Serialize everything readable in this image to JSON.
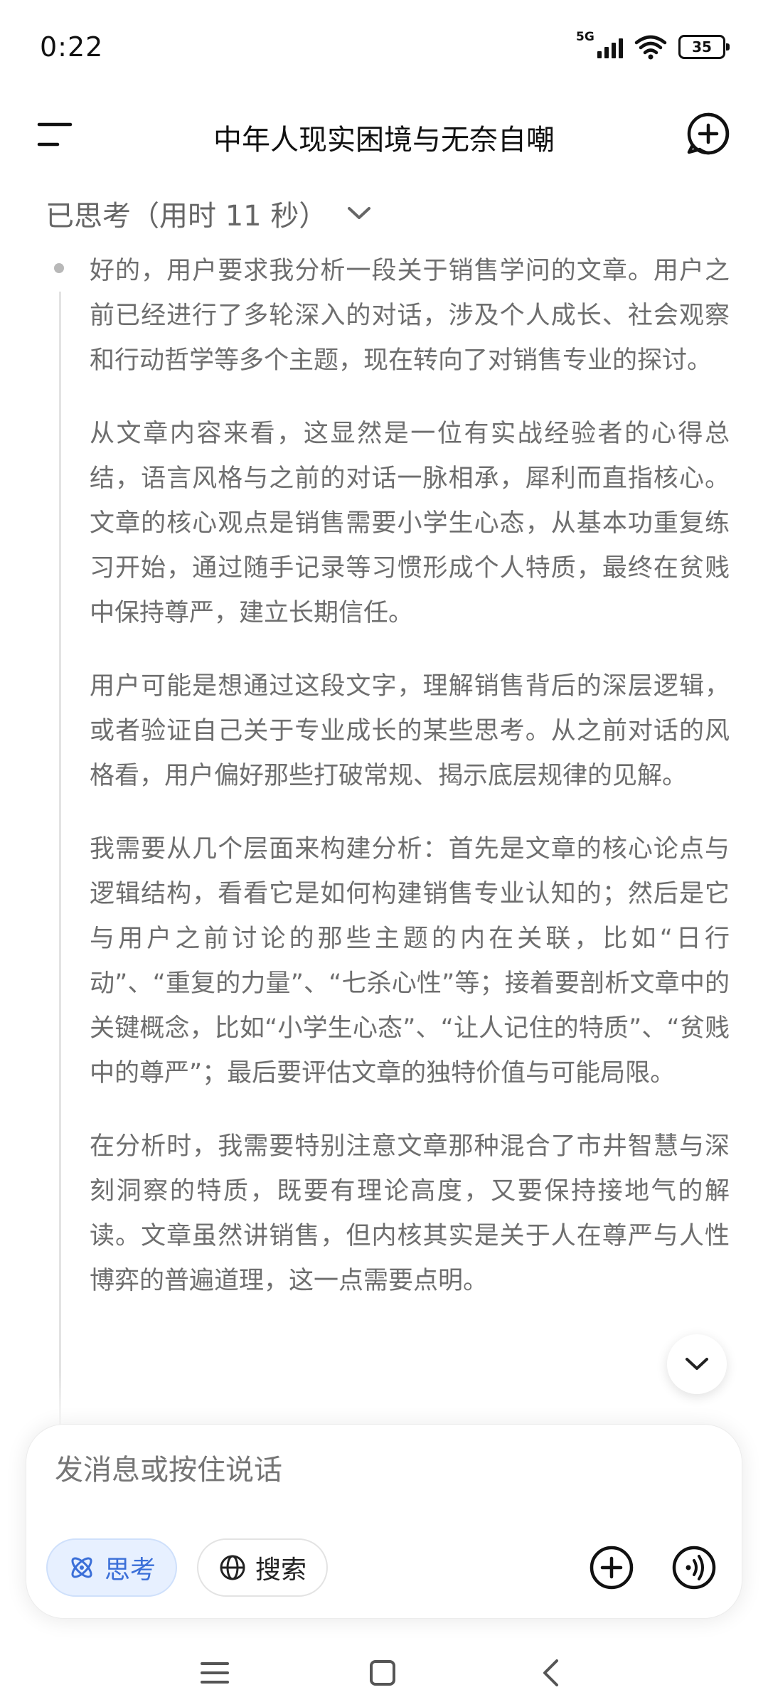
{
  "status_bar": {
    "time": "0:22",
    "network": "5G",
    "battery": "35"
  },
  "header": {
    "title": "中年人现实困境与无奈自嘲",
    "menu_icon": "hamburger-icon",
    "new_chat_icon": "new-chat-plus-icon"
  },
  "thinking": {
    "label": "已思考（用时 11 秒）",
    "paragraphs": [
      "好的，用户要求我分析一段关于销售学问的文章。用户之前已经进行了多轮深入的对话，涉及个人成长、社会观察和行动哲学等多个主题，现在转向了对销售专业的探讨。",
      "从文章内容来看，这显然是一位有实战经验者的心得总结，语言风格与之前的对话一脉相承，犀利而直指核心。文章的核心观点是销售需要小学生心态，从基本功重复练习开始，通过随手记录等习惯形成个人特质，最终在贫贱中保持尊严，建立长期信任。",
      "用户可能是想通过这段文字，理解销售背后的深层逻辑，或者验证自己关于专业成长的某些思考。从之前对话的风格看，用户偏好那些打破常规、揭示底层规律的见解。",
      "我需要从几个层面来构建分析：首先是文章的核心论点与逻辑结构，看看它是如何构建销售专业认知的；然后是它与用户之前讨论的那些主题的内在关联，比如“日行动”、“重复的力量”、“七杀心性”等；接着要剖析文章中的关键概念，比如“小学生心态”、“让人记住的特质”、“贫贱中的尊严”；最后要评估文章的独特价值与可能局限。",
      "在分析时，我需要特别注意文章那种混合了市井智慧与深刻洞察的特质，既要有理论高度，又要保持接地气的解读。文章虽然讲销售，但内核其实是关于人在尊严与人性博弈的普遍道理，这一点需要点明。"
    ]
  },
  "composer": {
    "placeholder": "发消息或按住说话",
    "think_label": "思考",
    "search_label": "搜索"
  },
  "colors": {
    "accent": "#3b6fd8",
    "accent_bg": "#e7f0ff",
    "thinking_text": "#6e6e6e"
  }
}
